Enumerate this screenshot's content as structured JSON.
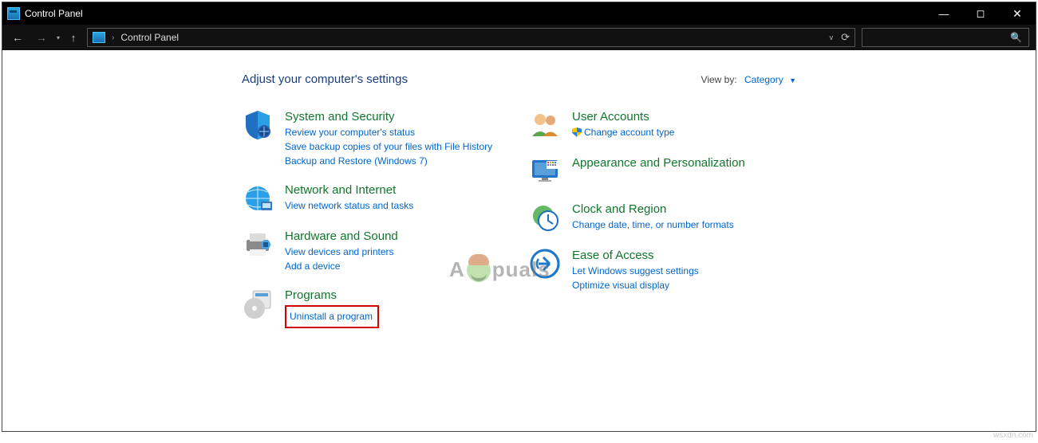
{
  "window": {
    "title": "Control Panel"
  },
  "addressbar": {
    "path": "Control Panel"
  },
  "heading": "Adjust your computer's settings",
  "viewby": {
    "label": "View by:",
    "value": "Category"
  },
  "left_categories": [
    {
      "title": "System and Security",
      "links": [
        "Review your computer's status",
        "Save backup copies of your files with File History",
        "Backup and Restore (Windows 7)"
      ]
    },
    {
      "title": "Network and Internet",
      "links": [
        "View network status and tasks"
      ]
    },
    {
      "title": "Hardware and Sound",
      "links": [
        "View devices and printers",
        "Add a device"
      ]
    },
    {
      "title": "Programs",
      "links": [
        "Uninstall a program"
      ]
    }
  ],
  "right_categories": [
    {
      "title": "User Accounts",
      "links": [
        "Change account type"
      ],
      "shield": [
        true
      ]
    },
    {
      "title": "Appearance and Personalization",
      "links": []
    },
    {
      "title": "Clock and Region",
      "links": [
        "Change date, time, or number formats"
      ]
    },
    {
      "title": "Ease of Access",
      "links": [
        "Let Windows suggest settings",
        "Optimize visual display"
      ]
    }
  ],
  "watermark": {
    "pre": "A",
    "post": "puals"
  },
  "credit": "wsxdn.com"
}
